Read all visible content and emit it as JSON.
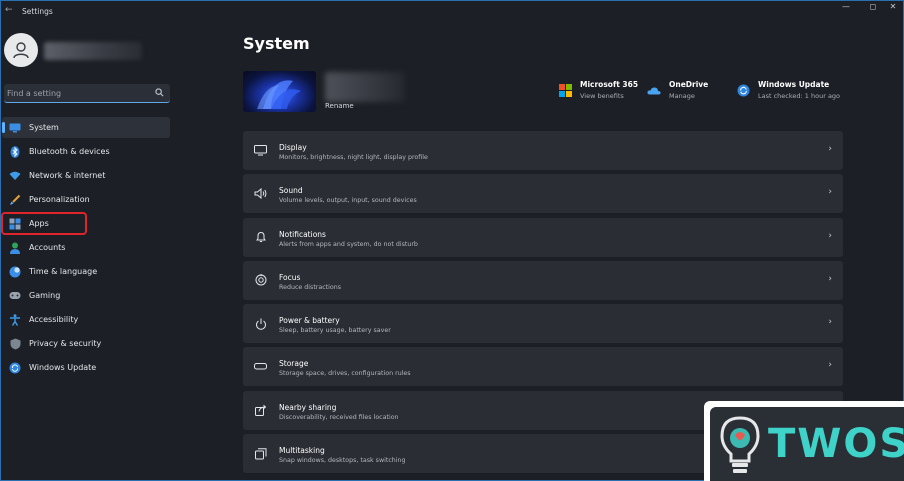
{
  "window": {
    "title": "Settings",
    "back": "←",
    "minimize": "—",
    "maximize": "◻",
    "close": "✕"
  },
  "sidebar": {
    "search_placeholder": "Find a setting",
    "items": [
      {
        "label": "System",
        "icon": "system-icon"
      },
      {
        "label": "Bluetooth & devices",
        "icon": "bluetooth-icon"
      },
      {
        "label": "Network & internet",
        "icon": "wifi-icon"
      },
      {
        "label": "Personalization",
        "icon": "brush-icon"
      },
      {
        "label": "Apps",
        "icon": "apps-icon"
      },
      {
        "label": "Accounts",
        "icon": "person-icon"
      },
      {
        "label": "Time & language",
        "icon": "globe-clock-icon"
      },
      {
        "label": "Gaming",
        "icon": "gamepad-icon"
      },
      {
        "label": "Accessibility",
        "icon": "accessibility-icon"
      },
      {
        "label": "Privacy & security",
        "icon": "shield-icon"
      },
      {
        "label": "Windows Update",
        "icon": "update-icon"
      }
    ],
    "selected": "System",
    "highlighted": "Apps"
  },
  "main": {
    "title": "System",
    "device": {
      "rename": "Rename"
    },
    "quick_links": [
      {
        "title": "Microsoft 365",
        "subtitle": "View benefits",
        "icon": "microsoft-icon"
      },
      {
        "title": "OneDrive",
        "subtitle": "Manage",
        "icon": "cloud-icon"
      },
      {
        "title": "Windows Update",
        "subtitle": "Last checked: 1 hour ago",
        "icon": "sync-icon"
      }
    ],
    "cards": [
      {
        "title": "Display",
        "subtitle": "Monitors, brightness, night light, display profile",
        "icon": "monitor-icon"
      },
      {
        "title": "Sound",
        "subtitle": "Volume levels, output, input, sound devices",
        "icon": "speaker-icon"
      },
      {
        "title": "Notifications",
        "subtitle": "Alerts from apps and system, do not disturb",
        "icon": "bell-icon"
      },
      {
        "title": "Focus",
        "subtitle": "Reduce distractions",
        "icon": "focus-icon"
      },
      {
        "title": "Power & battery",
        "subtitle": "Sleep, battery usage, battery saver",
        "icon": "power-icon"
      },
      {
        "title": "Storage",
        "subtitle": "Storage space, drives, configuration rules",
        "icon": "storage-icon"
      },
      {
        "title": "Nearby sharing",
        "subtitle": "Discoverability, received files location",
        "icon": "share-icon"
      },
      {
        "title": "Multitasking",
        "subtitle": "Snap windows, desktops, task switching",
        "icon": "multitask-icon"
      }
    ],
    "chevron": "›"
  },
  "watermark": {
    "text": "TWOS"
  },
  "colors": {
    "accent": "#5fb2ff",
    "highlight_box": "#e0242b",
    "background": "#1c1f26",
    "card": "#2a2d34"
  }
}
